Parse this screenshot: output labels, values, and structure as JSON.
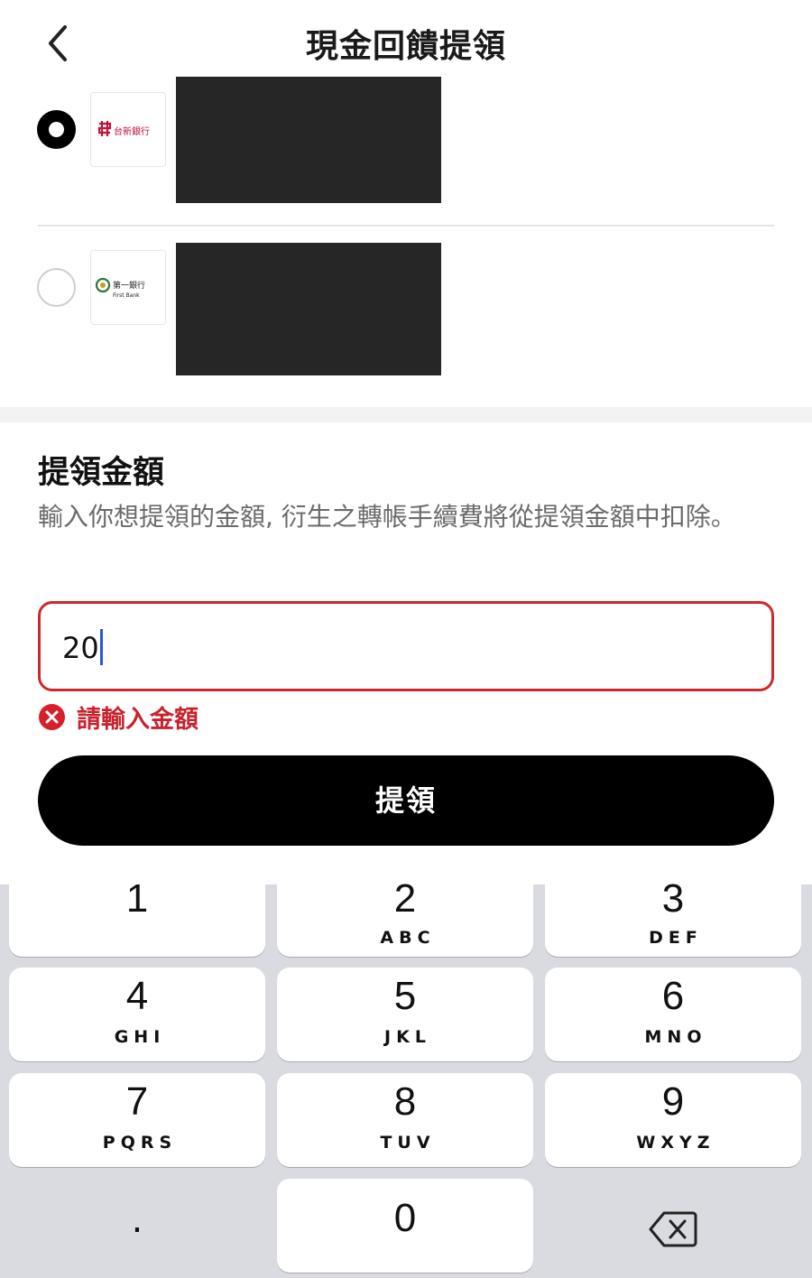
{
  "header": {
    "title": "現金回饋提領",
    "back_icon": "chevron-left-icon"
  },
  "banks": [
    {
      "selected": true,
      "logo_text": "台新銀行",
      "brand_color": "#c0113a"
    },
    {
      "selected": false,
      "logo_text": "第一銀行",
      "logo_subtext": "First Bank",
      "brand_color": "#2a7a3a"
    }
  ],
  "amount": {
    "title": "提領金額",
    "description": "輸入你想提領的金額, 衍生之轉帳手續費將從提領金額中扣除。",
    "value": "20",
    "error": "請輸入金額"
  },
  "submit_label": "提領",
  "keypad": {
    "keys": [
      {
        "num": "1",
        "letters": ""
      },
      {
        "num": "2",
        "letters": "ABC"
      },
      {
        "num": "3",
        "letters": "DEF"
      },
      {
        "num": "4",
        "letters": "GHI"
      },
      {
        "num": "5",
        "letters": "JKL"
      },
      {
        "num": "6",
        "letters": "MNO"
      },
      {
        "num": "7",
        "letters": "PQRS"
      },
      {
        "num": "8",
        "letters": "TUV"
      },
      {
        "num": "9",
        "letters": "WXYZ"
      },
      {
        "num": "0",
        "letters": ""
      }
    ],
    "dot": ".",
    "delete_icon": "backspace-icon"
  },
  "colors": {
    "error": "#c7232d",
    "input_border_error": "#cc2a2a",
    "caret": "#2a56d6",
    "button": "#000000",
    "keypad_bg": "#d9dbe0"
  }
}
